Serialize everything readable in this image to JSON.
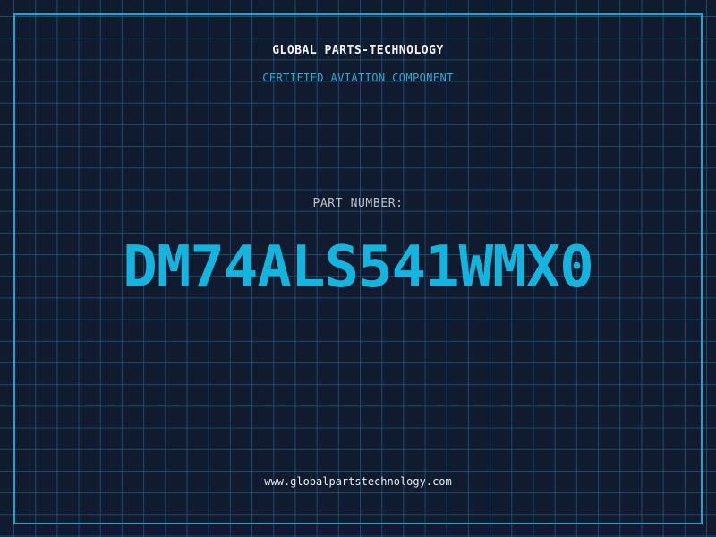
{
  "header": {
    "brand": "GLOBAL PARTS-TECHNOLOGY",
    "tagline": "CERTIFIED AVIATION COMPONENT"
  },
  "main": {
    "label": "PART NUMBER:",
    "part_number": "DM74ALS541WMX0"
  },
  "footer": {
    "url": "www.globalpartstechnology.com"
  },
  "colors": {
    "background": "#101b30",
    "grid": "#286e96",
    "frame": "#1fa3cf",
    "accent": "#15b4de",
    "text": "#f2f4f8"
  }
}
